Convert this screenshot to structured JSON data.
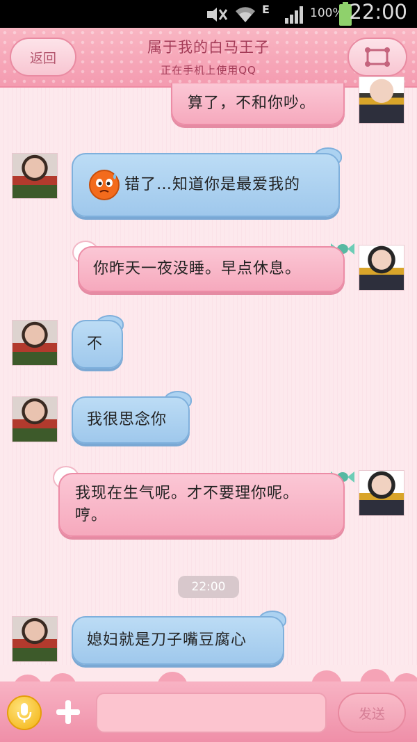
{
  "status_bar": {
    "network": "E",
    "battery": "100%",
    "time": "22:00"
  },
  "header": {
    "back_label": "返回",
    "title": "属于我的白马王子",
    "subtitle": "正在手机上使用QQ",
    "menu_icon": "contact-card-icon"
  },
  "messages": [
    {
      "side": "right",
      "text": "算了，不和你吵。"
    },
    {
      "side": "left",
      "emoji": "sweat-face-icon",
      "text": "错了…知道你是最爱我的"
    },
    {
      "side": "right",
      "text": "你昨天一夜没睡。早点休息。"
    },
    {
      "side": "left",
      "text": "不"
    },
    {
      "side": "left",
      "text": "我很思念你"
    },
    {
      "side": "right",
      "text": "我现在生气呢。才不要理你呢。哼。"
    },
    {
      "side": "left",
      "text": "媳妇就是刀子嘴豆腐心"
    }
  ],
  "timestamp": "22:00",
  "input_bar": {
    "input_value": "",
    "send_label": "发送"
  },
  "colors": {
    "header_pink": "#f49bb0",
    "bubble_blue": "#9fc8ec",
    "bubble_pink": "#f6a9bd",
    "background": "#fde8ec"
  }
}
